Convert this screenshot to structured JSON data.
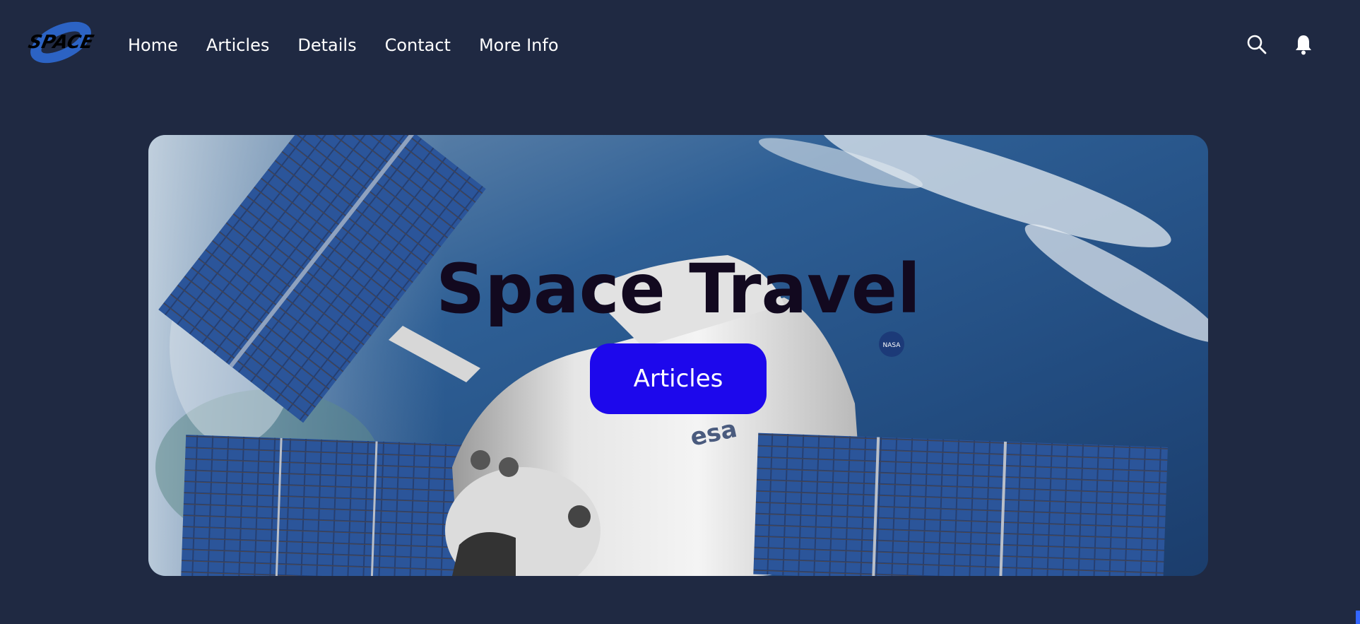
{
  "brand": {
    "logo_text": "SPACE"
  },
  "nav": {
    "links": [
      {
        "label": "Home"
      },
      {
        "label": "Articles"
      },
      {
        "label": "Details"
      },
      {
        "label": "Contact"
      },
      {
        "label": "More Info"
      }
    ],
    "icons": [
      "search-icon",
      "bell-icon"
    ]
  },
  "hero": {
    "title": "Space Travel",
    "button_label": "Articles",
    "image_labels": [
      "esa",
      "NASA"
    ]
  },
  "colors": {
    "page_background": "#1f2942",
    "accent_button": "#1d08ec",
    "title_text": "#12091f",
    "nav_text": "#ffffff"
  }
}
